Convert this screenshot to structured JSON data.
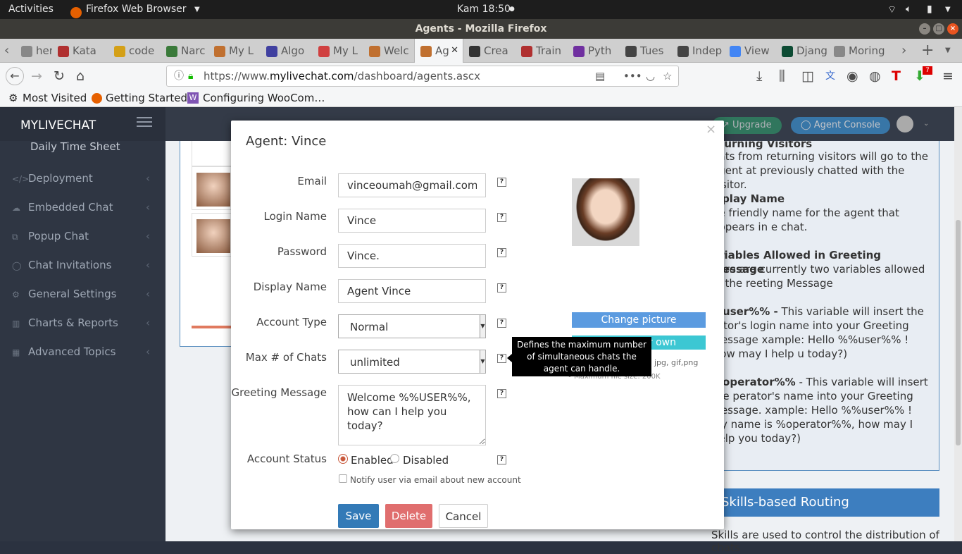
{
  "os": {
    "activities": "Activities",
    "app_menu": "Firefox Web Browser",
    "clock": "Kam 18:50"
  },
  "window": {
    "title": "Agents - Mozilla Firefox"
  },
  "tabs": [
    {
      "label": "her",
      "color": "#888"
    },
    {
      "label": "Kata",
      "color": "#b03030"
    },
    {
      "label": "code",
      "color": "#d4a017"
    },
    {
      "label": "Narc",
      "color": "#3a7a3a"
    },
    {
      "label": "My L",
      "color": "#c07030"
    },
    {
      "label": "Algo",
      "color": "#4040a0"
    },
    {
      "label": "My L",
      "color": "#d04040"
    },
    {
      "label": "Welc",
      "color": "#c07030"
    },
    {
      "label": "Ag",
      "color": "#c07030"
    },
    {
      "label": "Crea",
      "color": "#333"
    },
    {
      "label": "Train",
      "color": "#b03030"
    },
    {
      "label": "Pyth",
      "color": "#7030a0"
    },
    {
      "label": "Tues",
      "color": "#444"
    },
    {
      "label": "Indep",
      "color": "#444"
    },
    {
      "label": "View",
      "color": "#4285f4"
    },
    {
      "label": "Djang",
      "color": "#0c4b33"
    },
    {
      "label": "Moringa",
      "color": "#888"
    }
  ],
  "url": {
    "prefix": "https://www.",
    "domain": "mylivechat.com",
    "path": "/dashboard/agents.ascx"
  },
  "bookmarks": [
    "Most Visited",
    "Getting Started",
    "Configuring WooCom…"
  ],
  "sidebar": {
    "brand": "MYLIVECHAT",
    "items": [
      {
        "label": "Daily Time Sheet"
      },
      {
        "label": "Deployment",
        "icon": "</>"
      },
      {
        "label": "Embedded Chat",
        "icon": "☁"
      },
      {
        "label": "Popup Chat",
        "icon": "⧉"
      },
      {
        "label": "Chat Invitations",
        "icon": "◯"
      },
      {
        "label": "General Settings",
        "icon": "⚙"
      },
      {
        "label": "Charts & Reports",
        "icon": "▥"
      },
      {
        "label": "Advanced Topics",
        "icon": "▦"
      }
    ]
  },
  "header": {
    "upgrade": "Upgrade",
    "agent_console": "Agent Console"
  },
  "help": {
    "h_returning": "eturning Visitors",
    "p_returning": "hats from returning visitors will go to the agent at previously chatted with the visitor.",
    "h_display": "isplay Name",
    "p_display": "he friendly name for the agent that appears in e chat.",
    "h_vars": "ariables Allowed in Greeting Message",
    "p_vars": "here are currently two variables allowed in the reeting Message",
    "h_user": "%user%% -",
    "p_user": " This variable will insert the isitor's login name into your Greeting Message xample: Hello %%user%% ! How may I help u today?)",
    "h_op": "%operator%%",
    "p_op": " - This variable will insert the perator's name into your Greeting Message. xample: Hello %%user%% ! My name is %operator%%, how may I help you today?)",
    "skills": "Skills-based Routing",
    "skills_p": "Skills are used to control the distribution of chats"
  },
  "modal": {
    "title": "Agent: Vince",
    "close": "×",
    "email_label": "Email",
    "email": "vinceoumah@gmail.com",
    "login_label": "Login Name",
    "login": "Vince",
    "password_label": "Password",
    "password": "Vince.",
    "display_label": "Display Name",
    "display": "Agent Vince",
    "account_type_label": "Account Type",
    "account_type": "Normal",
    "max_chats_label": "Max # of Chats",
    "max_chats": "unlimited",
    "greeting_label": "Greeting Message",
    "greeting": "Welcome %%USER%%, how can I help you today?",
    "status_label": "Account Status",
    "enabled": "Enabled",
    "disabled": "Disabled",
    "notify": "Notify user via email about new account",
    "change_picture": "Change picture",
    "upload_own": "r own",
    "file_types": ", jpg, gif,png",
    "file_size": "• Maximum file size: 200K",
    "tooltip": "Defines the maximum number of simultaneous chats the agent can handle.",
    "save": "Save",
    "delete": "Delete",
    "cancel": "Cancel",
    "help_mark": "?"
  }
}
